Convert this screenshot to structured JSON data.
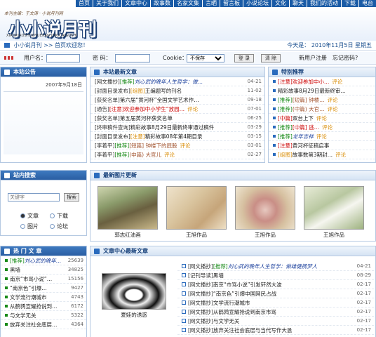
{
  "topnav": {
    "items": [
      "首页",
      "关于我们",
      "文章中心",
      "故事数",
      "名家文集",
      "言晒",
      "留言板",
      "小说论坛",
      "文化",
      "聊天",
      "我们的活动",
      "下载",
      "电台"
    ]
  },
  "logo": {
    "tagline": "本刊主编：于文涛 · 小说月刊网",
    "title": "小小说月刊",
    "pinyin": "XIAOXIAOSHUOYUEKAN  JINGCAIGUSHI"
  },
  "crumb": {
    "site": "小小说月刊",
    "sep": " >> ",
    "home": "首页欢迎您！",
    "date_text": "今天是：   2010年11月5日  星期五"
  },
  "login": {
    "user_label": "用户名：",
    "user_value": "",
    "pass_label": "密  码：",
    "pass_value": "",
    "cookie_label": "Cookie：",
    "cookie_option": "不保存",
    "login_btn": "登 录",
    "clear_btn": "清 除",
    "register": "新用户注册",
    "forgot": "忘记密码?"
  },
  "notice": {
    "title": "本站公告",
    "date": "2007年9月18日"
  },
  "latest": {
    "title": "本站最新文章",
    "rows": [
      {
        "cat": "[网文播抄]",
        "tag": "[推荐]",
        "text": "刘心武的晚年人生哲学：做…",
        "date": "04-21",
        "tagc": "grn",
        "textc": "it2"
      },
      {
        "cat": "[封面目录发布]",
        "tag": "[组图]",
        "text": "王编题写的刊名",
        "date": "11-02",
        "tagc": "rec",
        "textc": ""
      },
      {
        "cat": "[获奖名单]",
        "tag": "",
        "text": "第六届“黄河杯”全国文学艺术作…",
        "date": "09-18",
        "tagc": "",
        "textc": ""
      },
      {
        "cat": "[通告]",
        "tag": "[注意]",
        "text": "欢迎参加中小学生“放园…",
        "date": "07-01",
        "tagc": "red",
        "textc": "red",
        "extra": "评论"
      },
      {
        "cat": "[获奖名单]",
        "tag": "",
        "text": "第五届黄河杯获奖名单",
        "date": "06-25",
        "tagc": "",
        "textc": ""
      },
      {
        "cat": "[终审稿件查询]",
        "tag": "",
        "text": "精彩故事8月29日最新终审通过稿件",
        "date": "03-29",
        "tagc": "",
        "textc": ""
      },
      {
        "cat": "[封面目录发布]",
        "tag": "[注意]",
        "text": "精彩故事08年第4期目录",
        "date": "03-15",
        "tagc": "rec",
        "textc": ""
      },
      {
        "cat": "[李着平]",
        "tag": "[推荐]",
        "text": "[短篇] 钟楼下的屁股",
        "date": "03-01",
        "tagc": "grn",
        "textc": "brown",
        "extra": "评论"
      },
      {
        "cat": "[李着平]",
        "tag": "[推荐]",
        "text": "(中篇) 大官儿",
        "date": "02-27",
        "tagc": "grn",
        "textc": "brown",
        "extra": "评论"
      }
    ]
  },
  "special": {
    "title": "特别推荐",
    "rows": [
      {
        "tag": "[注意]",
        "text": "欢迎参加中小…",
        "extra": "评论",
        "tagc": "red",
        "textc": "red"
      },
      {
        "tag": "",
        "text": "精彩故事8月29日最新终审…",
        "extra": "",
        "tagc": "",
        "textc": ""
      },
      {
        "tag": "[推荐]",
        "text": "[短篇] 钟楼…",
        "extra": "评论",
        "tagc": "grn",
        "textc": "brown"
      },
      {
        "tag": "[推荐]",
        "text": "(中篇) 大官…",
        "extra": "评论",
        "tagc": "grn",
        "textc": "brown"
      },
      {
        "tag": "[中篇]",
        "text": "双台上下",
        "extra": "评论",
        "tagc": "red",
        "textc": ""
      },
      {
        "tag": "[推荐]",
        "text": "[中篇] 逃…",
        "extra": "评论",
        "tagc": "grn",
        "textc": "red"
      },
      {
        "tag": "[推荐]",
        "text": "龙年吉祥",
        "extra": "评论",
        "tagc": "grn",
        "textc": "it2"
      },
      {
        "tag": "[注意]",
        "text": "黄河杯征稿启事",
        "extra": "",
        "tagc": "red",
        "textc": ""
      },
      {
        "tag": "[组图]",
        "text": "故事数第3期封…",
        "extra": "评论",
        "tagc": "rec",
        "textc": ""
      }
    ]
  },
  "search": {
    "title": "站内搜索",
    "placeholder": "关键字",
    "btn": "搜索",
    "opt1": "文章",
    "opt2": "下载",
    "opt3": "图片",
    "opt4": "论坛"
  },
  "gallery": {
    "title": "最新图片更新",
    "items": [
      "郭志红油画",
      "王旭作品",
      "王旭作品",
      "王旭作品"
    ]
  },
  "hot": {
    "title": "热 门 文 章",
    "rows": [
      {
        "tag": "[推荐]",
        "text": "刘心武的晚年…",
        "n": "25639",
        "textc": "it2"
      },
      {
        "tag": "",
        "text": "黑墙",
        "n": "34825",
        "textc": ""
      },
      {
        "tag": "",
        "text": "南京“市骂小说”…",
        "n": "15156",
        "textc": ""
      },
      {
        "tag": "",
        "text": "“南京色”引爆…",
        "n": "9427",
        "textc": ""
      },
      {
        "tag": "",
        "text": "文学流行潮城市",
        "n": "4743",
        "textc": ""
      },
      {
        "tag": "",
        "text": "从鹤鹑宣耀抢说到…",
        "n": "6172",
        "textc": ""
      },
      {
        "tag": "",
        "text": "与文学无关",
        "n": "5322",
        "textc": ""
      },
      {
        "tag": "",
        "text": "放弃关注社会底层…",
        "n": "4364",
        "textc": ""
      }
    ]
  },
  "center": {
    "title": "文章中心最新文章",
    "pic_caption": "夏娃的诱惑",
    "rows": [
      {
        "cat": "[网文播抄]",
        "tag": "[推荐]",
        "text": "刘心武的晚年人生哲学：做雄健携梦人",
        "date": "04-21",
        "textc": "it2"
      },
      {
        "cat": "[记刊导读]",
        "tag": "",
        "text": "黑墙",
        "date": "08-29",
        "textc": ""
      },
      {
        "cat": "[网文播抄]",
        "tag": "",
        "text": "南京“市骂小说”引发轩然大波",
        "date": "02-17",
        "textc": ""
      },
      {
        "cat": "[网文播抄]",
        "tag": "",
        "text": "“南京色”引爆中国网民占战",
        "date": "02-17",
        "textc": ""
      },
      {
        "cat": "[网文播抄]",
        "tag": "",
        "text": "文学流行潮城市",
        "date": "02-17",
        "textc": ""
      },
      {
        "cat": "[网文播抄]",
        "tag": "",
        "text": "从鹤鹑宣耀抢说到南京市骂",
        "date": "02-17",
        "textc": ""
      },
      {
        "cat": "[网文播抄]",
        "tag": "",
        "text": "与文学无关",
        "date": "02-17",
        "textc": ""
      },
      {
        "cat": "[网文播抄]",
        "tag": "",
        "text": "放弃关注社会底层与当代写作大恳",
        "date": "02-17",
        "textc": ""
      }
    ]
  },
  "colors": {
    "nav": "#1a5ba6",
    "panel_border": "#b5c9e2",
    "header_dark": "#2a5ea3"
  }
}
